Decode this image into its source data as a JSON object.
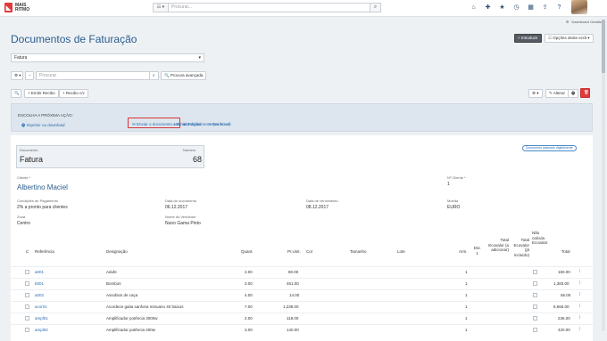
{
  "logo": {
    "line1": "MAIS",
    "line2": "RITMO"
  },
  "topbar": {
    "search_placeholder": "Procurar...",
    "search_mode": "☷ ▾"
  },
  "user": {
    "name": "Dashboard Gestão"
  },
  "page": {
    "title": "Documentos de Faturação"
  },
  "header_buttons": {
    "new": "+ Introduzir",
    "options": "☷ Opções deste ecrã ▾"
  },
  "doctype_select": {
    "value": "Fatura"
  },
  "search_bar": {
    "placeholder": "Procurar",
    "advanced": "🔍 Procura avançada"
  },
  "toolbar": {
    "zoom": "🔍",
    "receipt": "+ Emitir Recibo",
    "receipt_cc": "+ Recibo c/c",
    "settings": "⚙ ▾",
    "edit": "✎ Alterar",
    "print": "🖶",
    "delete": "🗑"
  },
  "actions": {
    "title": "ESCOLHA A PRÓXIMA AÇÃO:",
    "print": "🖶 Imprimir ou download",
    "email": "✉ Enviar o documento assinado digitalmente por email",
    "receipt": "+ Emitir Recibo",
    "receipt_cc": "+ Recibo c/c"
  },
  "document": {
    "type_label": "Documento",
    "type_value": "Fatura",
    "number_label": "Número",
    "number_value": "68",
    "badge": "Documento assinado digitalmente"
  },
  "fields": {
    "client_label": "Cliente *",
    "client_value": "Albertino Maciel",
    "client_no_label": "Nº Cliente *",
    "client_no_value": "1",
    "payment_label": "Condições de Pagamento",
    "payment_value": "2% a pronto para clientes",
    "doc_date_label": "Data do documento",
    "doc_date_value": "06.12.2017",
    "due_date_label": "Data de vencimento",
    "due_date_value": "08.12.2017",
    "currency_label": "Moeda",
    "currency_value": "EURO",
    "zone_label": "Zona",
    "zone_value": "Centro",
    "seller_label": "Nome do Vendedor",
    "seller_value": "Nuno Gama Pinto"
  },
  "table": {
    "headers": {
      "c": "C",
      "ref": "Referência",
      "desc": "Designação",
      "qty": "Quant.",
      "price": "Pr.Unit.",
      "color": "Cor",
      "size": "Tamanho",
      "lot": "Lote",
      "wh": "Arm.",
      "disc": "Dsc 1",
      "eco_add": "Total Ecovalor (a adicionar)",
      "eco_inc": "Total Ecovalor (já incluído)",
      "no_eco": "Não calcula Ecovalor",
      "total": "Total"
    },
    "rows": [
      {
        "ref": "a001",
        "desc": "Adufe",
        "qty": "2.00",
        "price": "80.00",
        "wh": "1",
        "total": "160.00"
      },
      {
        "ref": "b001",
        "desc": "Bombos",
        "qty": "3.00",
        "price": "461.00",
        "wh": "1",
        "total": "1,383.00"
      },
      {
        "ref": "a002",
        "desc": "Assobios de caça",
        "qty": "4.00",
        "price": "14.00",
        "wh": "1",
        "total": "56.00"
      },
      {
        "ref": "acor01",
        "desc": "Acordeon gaita sanfona minuano 40 baixos",
        "qty": "7.00",
        "price": "1,238.00",
        "wh": "1",
        "total": "8,666.00"
      },
      {
        "ref": "ampl01",
        "desc": "Amplificador potência 3000w",
        "qty": "2.00",
        "price": "118.00",
        "wh": "1",
        "total": "236.00"
      },
      {
        "ref": "ampl02",
        "desc": "Amplificador potência 400w",
        "qty": "3.00",
        "price": "140.00",
        "wh": "1",
        "total": "420.00"
      }
    ]
  }
}
